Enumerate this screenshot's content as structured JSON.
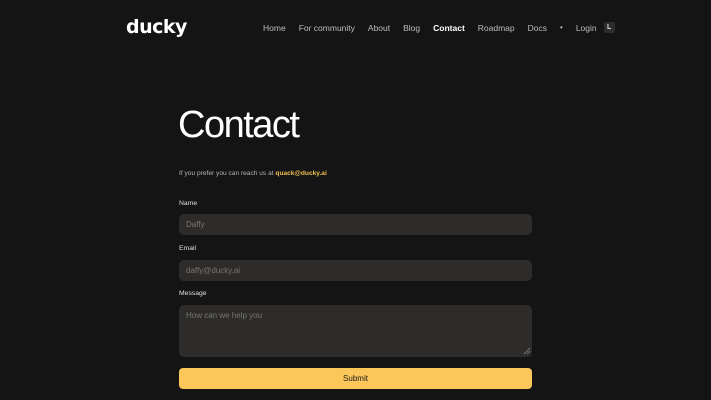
{
  "brand": {
    "logo_text": "ducky"
  },
  "nav": {
    "items": [
      "Home",
      "For community",
      "About",
      "Blog",
      "Contact",
      "Roadmap",
      "Docs"
    ],
    "active": "Contact",
    "separator": "•",
    "login_label": "Login",
    "login_shortcut": "L"
  },
  "main": {
    "title": "Contact",
    "intro_text": "If you prefer you can reach us at",
    "contact_email": "quack@ducky.ai"
  },
  "form": {
    "name_label": "Name",
    "name_placeholder": "Daffy",
    "email_label": "Email",
    "email_placeholder": "daffy@ducky.ai",
    "message_label": "Message",
    "message_placeholder": "How can we help you",
    "submit_label": "Submit"
  },
  "colors": {
    "background": "#141414",
    "field_bg": "#2e2c2a",
    "accent": "#fbc65a",
    "link": "#f0c050"
  }
}
